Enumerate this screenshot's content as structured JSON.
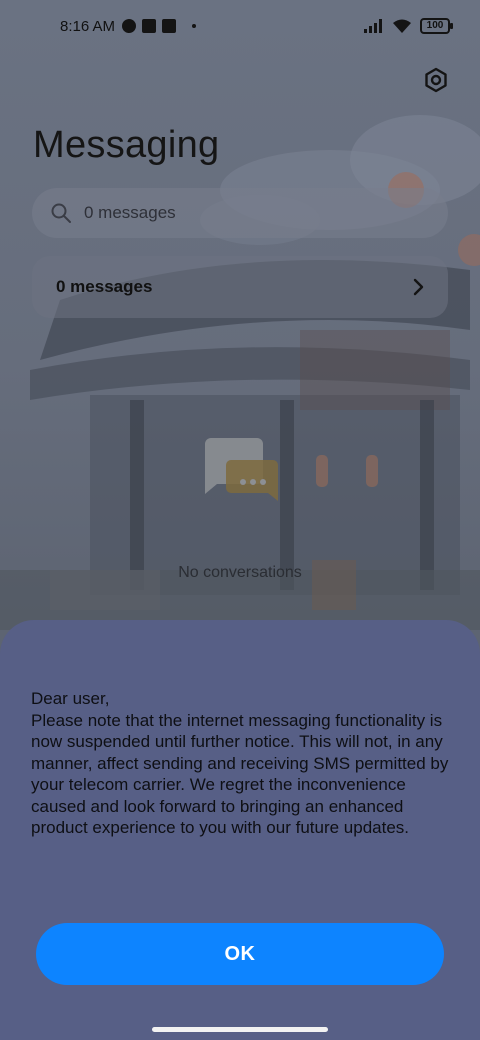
{
  "status_bar": {
    "time": "8:16 AM",
    "battery": "100"
  },
  "header": {
    "title": "Messaging",
    "settings_icon": "gear-icon"
  },
  "search": {
    "placeholder": "0 messages",
    "icon": "search-icon"
  },
  "summary": {
    "label": "0 messages",
    "icon": "chevron-right-icon"
  },
  "empty_state": {
    "text": "No conversations",
    "icon": "chat-bubble-icon"
  },
  "dialog": {
    "message": "Dear user,\nPlease note that the internet messaging functionality is now suspended until further notice. This will not, in any manner, affect sending and receiving SMS permitted by your telecom carrier. We regret the inconvenience caused and look forward to bringing an enhanced product experience to you with our future updates.",
    "ok_label": "OK"
  },
  "colors": {
    "accent": "#0d84ff",
    "sheet": "#575f86"
  }
}
